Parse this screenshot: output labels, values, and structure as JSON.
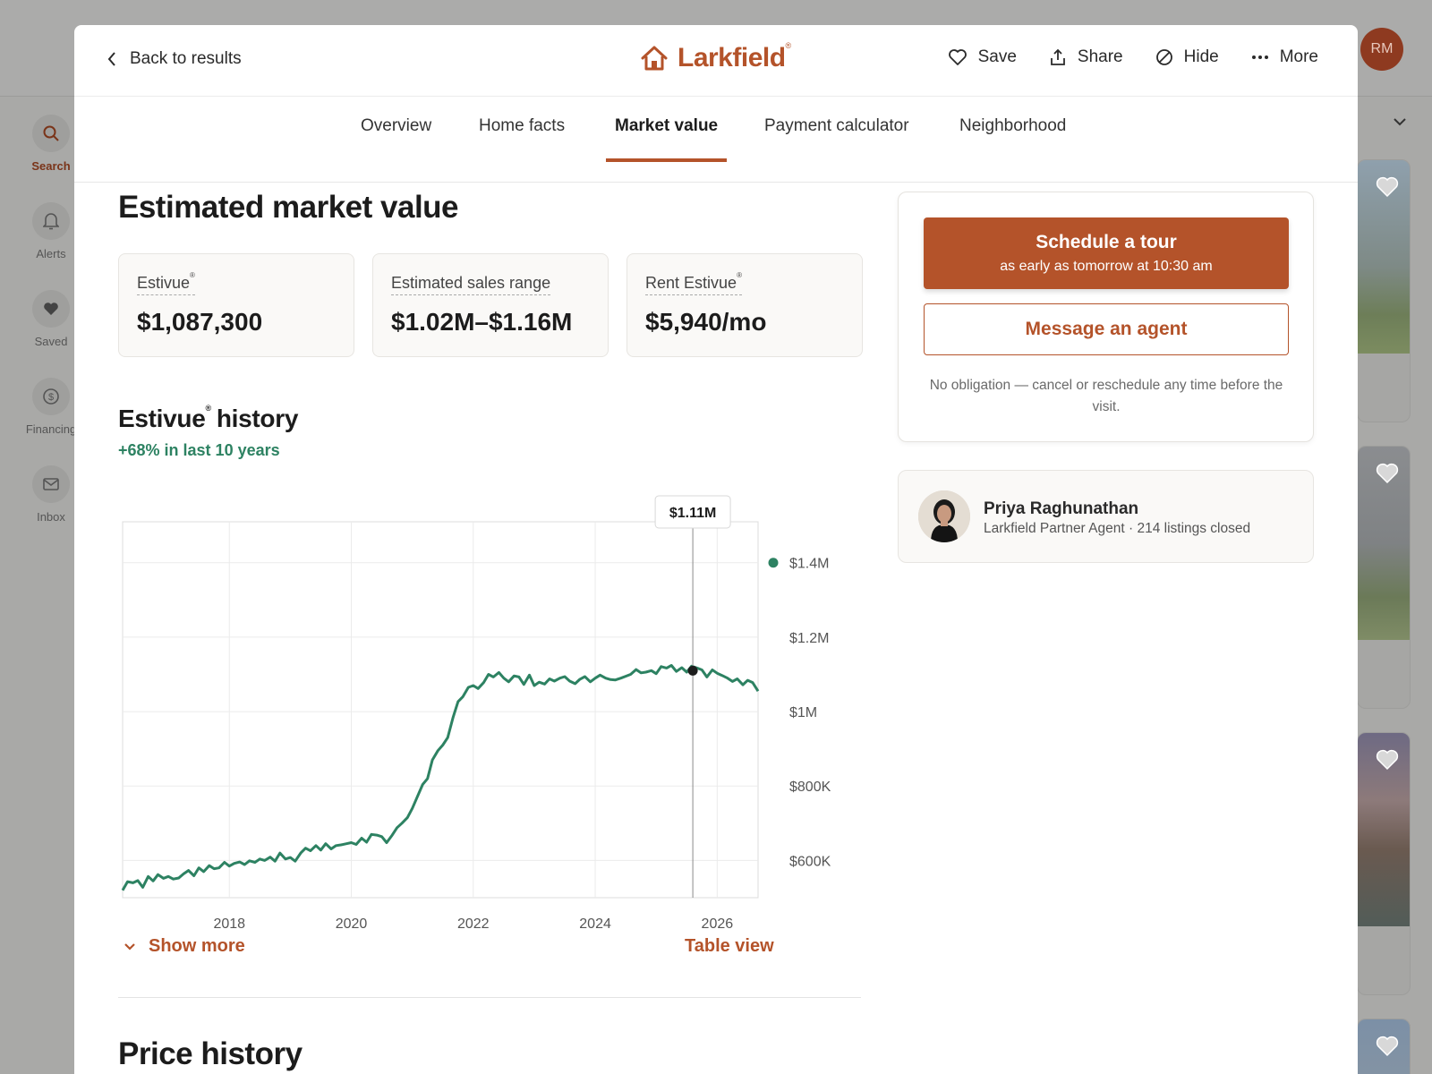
{
  "background": {
    "user_initials": "RM",
    "rail": [
      {
        "label": "Search",
        "icon": "search-icon"
      },
      {
        "label": "Alerts",
        "icon": "bell-icon"
      },
      {
        "label": "Saved",
        "icon": "heart-icon"
      },
      {
        "label": "Financing",
        "icon": "dollar-icon"
      },
      {
        "label": "Inbox",
        "icon": "mail-icon"
      }
    ]
  },
  "header": {
    "back_label": "Back to results",
    "brand": "Larkfield",
    "brand_mark": "®",
    "actions": {
      "save": "Save",
      "share": "Share",
      "hide": "Hide",
      "more": "More"
    }
  },
  "tabs": [
    "Overview",
    "Home facts",
    "Market value",
    "Payment calculator",
    "Neighborhood"
  ],
  "active_tab": "Market value",
  "main": {
    "title": "Estimated market value",
    "stats": [
      {
        "label": "Estivue",
        "mark": "®",
        "value": "$1,087,300"
      },
      {
        "label": "Estimated sales range",
        "mark": "",
        "value": "$1.02M–$1.16M"
      },
      {
        "label": "Rent Estivue",
        "mark": "®",
        "value": "$5,940/mo"
      }
    ],
    "history_title_a": "Estivue",
    "history_mark": "®",
    "history_title_b": "history",
    "growth": "+68% in last 10 years",
    "show_more": "Show more",
    "table_view": "Table view",
    "price_history_title": "Price history"
  },
  "side": {
    "tour_title": "Schedule a tour",
    "tour_sub": "as early as tomorrow at 10:30 am",
    "message_label": "Message an agent",
    "note": "No obligation — cancel or reschedule any time before the visit."
  },
  "agent": {
    "name": "Priya Raghunathan",
    "subtitle": "Larkfield Partner Agent · 214 listings closed"
  },
  "colors": {
    "accent": "#b4532a",
    "line": "#2d8262",
    "growth": "#2d8262"
  },
  "chart_data": {
    "type": "line",
    "title": "",
    "xlabel": "",
    "ylabel": "",
    "x_ticks": [
      2018,
      2020,
      2022,
      2024,
      2026
    ],
    "y_ticks": [
      "$1.4M",
      "$1.2M",
      "$1M",
      "$800K",
      "$600K"
    ],
    "y_tick_values": [
      1400000,
      1200000,
      1000000,
      800000,
      600000
    ],
    "xlim": [
      2016.25,
      2026.67
    ],
    "ylim": [
      500000,
      1510000
    ],
    "grid": true,
    "legend_position": "right",
    "tooltip": {
      "x": 2025.6,
      "label": "$1.11M"
    },
    "series": [
      {
        "x": [
          2016.25,
          2016.33,
          2016.42,
          2016.5,
          2016.58,
          2016.67,
          2016.75,
          2016.83,
          2016.92,
          2017.0,
          2017.08,
          2017.17,
          2017.25,
          2017.33,
          2017.42,
          2017.5,
          2017.58,
          2017.67,
          2017.75,
          2017.83,
          2017.92,
          2018.0,
          2018.08,
          2018.17,
          2018.25,
          2018.33,
          2018.42,
          2018.5,
          2018.58,
          2018.67,
          2018.75,
          2018.83,
          2018.92,
          2019.0,
          2019.08,
          2019.17,
          2019.25,
          2019.33,
          2019.42,
          2019.5,
          2019.58,
          2019.67,
          2019.75,
          2019.83,
          2019.92,
          2020.0,
          2020.08,
          2020.17,
          2020.25,
          2020.33,
          2020.42,
          2020.5,
          2020.58,
          2020.67,
          2020.75,
          2020.83,
          2020.92,
          2021.0,
          2021.08,
          2021.17,
          2021.25,
          2021.33,
          2021.42,
          2021.5,
          2021.58,
          2021.67,
          2021.75,
          2021.83,
          2021.92,
          2022.0,
          2022.08,
          2022.17,
          2022.25,
          2022.33,
          2022.42,
          2022.5,
          2022.58,
          2022.67,
          2022.75,
          2022.83,
          2022.92,
          2023.0,
          2023.08,
          2023.17,
          2023.25,
          2023.33,
          2023.42,
          2023.5,
          2023.58,
          2023.67,
          2023.75,
          2023.83,
          2023.92,
          2024.0,
          2024.08,
          2024.17,
          2024.25,
          2024.33,
          2024.42,
          2024.5,
          2024.58,
          2024.67,
          2024.75,
          2024.83,
          2024.92,
          2025.0,
          2025.08,
          2025.17,
          2025.25,
          2025.33,
          2025.42,
          2025.5,
          2025.58,
          2025.67,
          2025.75,
          2025.83,
          2025.92,
          2026.0,
          2026.08,
          2026.17,
          2026.25,
          2026.33,
          2026.42,
          2026.5,
          2026.58,
          2026.67
        ],
        "values": [
          520000,
          543000,
          540000,
          546000,
          528000,
          557000,
          545000,
          562000,
          552000,
          557000,
          550000,
          553000,
          564000,
          573000,
          559000,
          580000,
          570000,
          586000,
          578000,
          580000,
          595000,
          585000,
          592000,
          596000,
          589000,
          599000,
          595000,
          604000,
          600000,
          609000,
          598000,
          620000,
          604000,
          608000,
          598000,
          620000,
          633000,
          626000,
          640000,
          628000,
          645000,
          631000,
          640000,
          642000,
          645000,
          648000,
          643000,
          660000,
          649000,
          670000,
          668000,
          664000,
          648000,
          668000,
          688000,
          700000,
          715000,
          740000,
          770000,
          804000,
          820000,
          870000,
          895000,
          910000,
          930000,
          985000,
          1027000,
          1040000,
          1065000,
          1070000,
          1062000,
          1078000,
          1100000,
          1093000,
          1105000,
          1090000,
          1080000,
          1096000,
          1093000,
          1073000,
          1098000,
          1070000,
          1079000,
          1074000,
          1088000,
          1082000,
          1090000,
          1094000,
          1082000,
          1075000,
          1087000,
          1094000,
          1080000,
          1090000,
          1098000,
          1090000,
          1086000,
          1085000,
          1090000,
          1095000,
          1100000,
          1113000,
          1104000,
          1106000,
          1110000,
          1102000,
          1121000,
          1117000,
          1124000,
          1108000,
          1118000,
          1106000,
          1122000,
          1117000,
          1112000,
          1093000,
          1112000,
          1103000,
          1097000,
          1090000,
          1081000,
          1088000,
          1072000,
          1084000,
          1078000,
          1055000
        ],
        "current": {
          "x": 2025.6,
          "value": 1110000
        }
      }
    ]
  }
}
